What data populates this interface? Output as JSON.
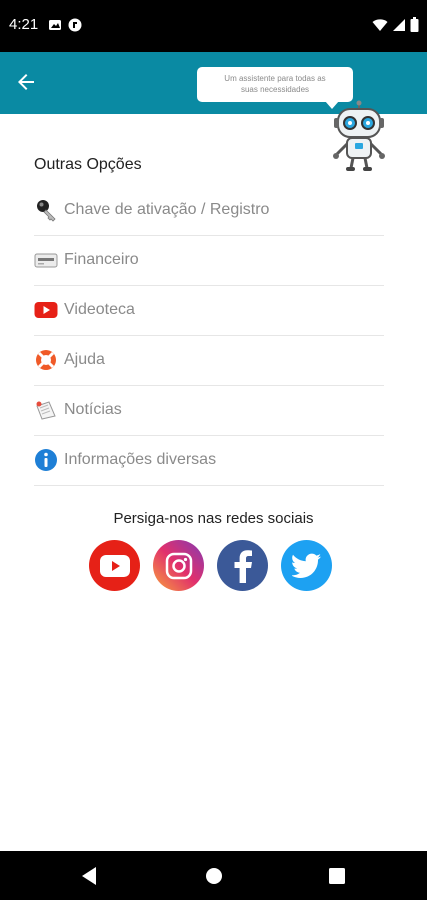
{
  "status_bar": {
    "time": "4:21"
  },
  "app_bar": {
    "tooltip_line1": "Um assistente para todas as",
    "tooltip_line2": "suas necessidades",
    "color": "#0a8aa3"
  },
  "section_title": "Outras Opções",
  "menu_items": [
    {
      "label": "Chave de ativação / Registro",
      "icon": "key-icon"
    },
    {
      "label": "Financeiro",
      "icon": "finance-icon"
    },
    {
      "label": "Videoteca",
      "icon": "youtube-icon"
    },
    {
      "label": "Ajuda",
      "icon": "lifebuoy-icon"
    },
    {
      "label": "Notícias",
      "icon": "news-icon"
    },
    {
      "label": "Informações diversas",
      "icon": "info-icon"
    }
  ],
  "social_title": "Persiga-nos nas redes sociais",
  "social": [
    {
      "name": "YouTube",
      "color": "#e62117"
    },
    {
      "name": "Instagram",
      "color": "#c13584"
    },
    {
      "name": "Facebook",
      "color": "#3b5998"
    },
    {
      "name": "Twitter",
      "color": "#1da1f2"
    }
  ]
}
